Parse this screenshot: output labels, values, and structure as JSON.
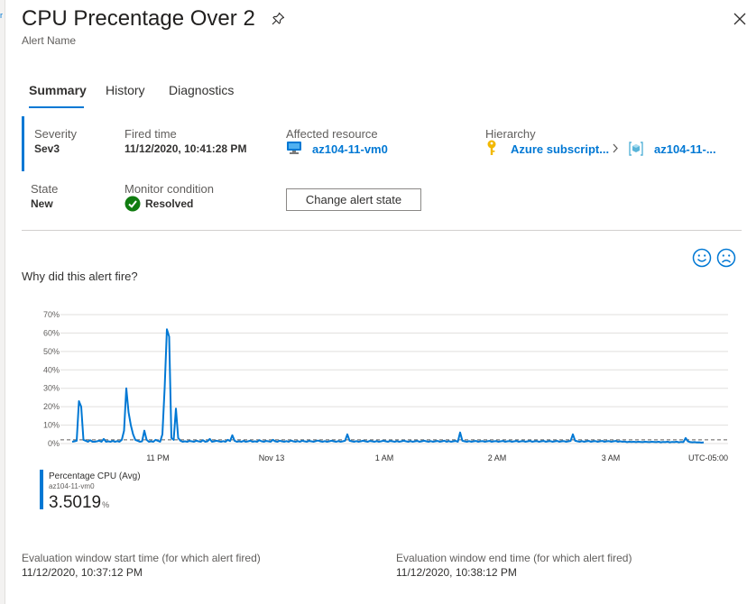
{
  "header": {
    "title": "CPU Precentage Over 2",
    "subtitle": "Alert Name"
  },
  "tabs": [
    {
      "label": "Summary",
      "active": true
    },
    {
      "label": "History",
      "active": false
    },
    {
      "label": "Diagnostics",
      "active": false
    }
  ],
  "summary": {
    "severity_label": "Severity",
    "severity_value": "Sev3",
    "fired_time_label": "Fired time",
    "fired_time_value": "11/12/2020, 10:41:28 PM",
    "affected_resource_label": "Affected resource",
    "affected_resource_value": "az104-11-vm0",
    "hierarchy_label": "Hierarchy",
    "hierarchy_subscription": "Azure subscript...",
    "hierarchy_group": "az104-11-...",
    "state_label": "State",
    "state_value": "New",
    "monitor_condition_label": "Monitor condition",
    "monitor_condition_value": "Resolved",
    "change_state_button": "Change alert state"
  },
  "why_fired": "Why did this alert fire?",
  "colors": {
    "accent": "#0078d4",
    "resolved_green": "#107c10",
    "key_gold": "#f2b800"
  },
  "chart_data": {
    "type": "line",
    "y_ticks": [
      "70%",
      "60%",
      "50%",
      "40%",
      "30%",
      "20%",
      "10%",
      "0%"
    ],
    "ylim": [
      0,
      70
    ],
    "x_ticks": [
      "11 PM",
      "Nov 13",
      "1 AM",
      "2 AM",
      "3 AM",
      "UTC-05:00"
    ],
    "threshold": 2,
    "grid": true,
    "series": [
      {
        "name": "Percentage CPU (Avg)",
        "resource": "az104-11-vm0",
        "color": "#0078d4",
        "values": [
          1,
          1.2,
          1.5,
          23,
          20,
          2,
          1.5,
          1,
          1.8,
          1,
          1,
          1.2,
          1.5,
          1,
          2.5,
          1,
          1.2,
          1,
          1.4,
          1,
          1.3,
          1,
          2,
          7,
          30,
          17,
          10,
          5,
          2,
          1.5,
          1,
          1.2,
          7,
          2,
          1,
          1.2,
          1,
          2,
          1.5,
          1,
          5,
          30,
          62,
          58,
          3,
          2,
          19,
          3,
          1.5,
          1,
          1.2,
          1,
          1.4,
          1.2,
          1,
          1.5,
          1.2,
          1,
          1.8,
          1,
          1.2,
          2.5,
          1,
          1.2,
          1.5,
          1.2,
          1,
          1.3,
          1,
          2,
          1.3,
          4.5,
          1.5,
          1,
          1.2,
          1,
          1.4,
          1,
          1.2,
          1.5,
          1,
          1.2,
          1,
          1.8,
          1.2,
          1,
          1.4,
          1.2,
          1,
          2,
          1.2,
          1,
          1.5,
          1.2,
          1,
          1.3,
          1,
          1.6,
          1.2,
          1,
          1.3,
          1,
          1.5,
          1.2,
          1,
          1.4,
          1.2,
          1,
          1.3,
          1.6,
          1.2,
          1,
          1.3,
          1,
          1.2,
          1.5,
          1.2,
          1,
          1.3,
          1,
          1.2,
          1.5,
          5,
          1.5,
          1.2,
          1,
          1.3,
          1,
          1.2,
          1.5,
          1.2,
          1,
          1.4,
          1.2,
          1,
          1.3,
          1,
          1.2,
          1.5,
          1.2,
          1,
          1.4,
          1.2,
          1,
          1.3,
          1,
          1.2,
          1.5,
          1.2,
          1,
          1.3,
          1,
          1.2,
          1.4,
          1,
          1.2,
          1.5,
          1.2,
          1,
          1.3,
          1,
          1.2,
          1.4,
          1,
          1.2,
          1.5,
          1,
          1.3,
          1,
          1.2,
          1.4,
          1,
          6,
          1.5,
          1.2,
          1,
          1.3,
          1,
          1.2,
          1.4,
          1,
          1.2,
          1.3,
          1,
          1.2,
          1.4,
          1,
          1.2,
          1.3,
          1,
          1.2,
          1.4,
          1,
          1.2,
          1.3,
          1,
          1.2,
          1.4,
          1,
          1.2,
          1.3,
          1,
          1.2,
          1.4,
          1,
          1.2,
          1.3,
          1,
          1.2,
          1.4,
          1,
          1.2,
          1.3,
          1,
          1.2,
          1.4,
          1,
          1.2,
          1.3,
          1,
          1.2,
          1.4,
          5,
          1.5,
          1.2,
          1,
          1.3,
          1,
          1.2,
          1.4,
          1,
          1.2,
          1.3,
          1,
          1.2,
          1.4,
          1,
          1.2,
          1.3,
          1,
          1.2,
          1.4,
          1,
          1.2,
          1,
          1.1,
          0.8,
          1,
          0.9,
          1,
          0.8,
          1,
          0.9,
          0.8,
          1,
          0.9,
          0.8,
          1,
          0.9,
          0.8,
          1,
          0.7,
          0.9,
          0.8,
          1,
          0.7,
          0.9,
          0.8,
          1,
          0.7,
          0.9,
          0.8,
          3,
          1.2,
          0.8,
          0.7,
          0.8,
          0.6,
          0.7,
          0.5,
          0.6
        ]
      }
    ]
  },
  "legend": {
    "metric": "Percentage CPU (Avg)",
    "resource": "az104-11-vm0",
    "value": "3.5019",
    "unit": "%"
  },
  "evaluation": {
    "start_label": "Evaluation window start time (for which alert fired)",
    "start_value": "11/12/2020, 10:37:12 PM",
    "end_label": "Evaluation window end time (for which alert fired)",
    "end_value": "11/12/2020, 10:38:12 PM"
  }
}
